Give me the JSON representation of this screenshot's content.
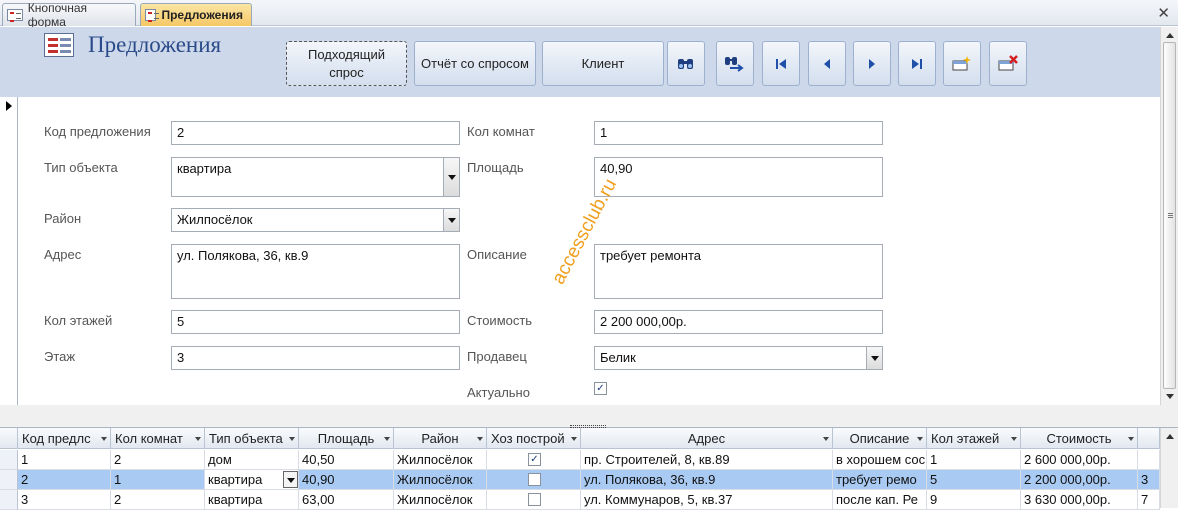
{
  "tabs": [
    {
      "label": "Кнопочная форма",
      "active": false
    },
    {
      "label": "Предложения",
      "active": true
    }
  ],
  "header": {
    "title": "Предложения",
    "buttons": {
      "match_demand_line1": "Подходящий",
      "match_demand_line2": "спрос",
      "report_demand": "Отчёт со спросом",
      "client": "Клиент"
    },
    "icon_buttons": [
      "find-icon",
      "replace-icon",
      "first-record-icon",
      "previous-record-icon",
      "next-record-icon",
      "last-record-icon",
      "new-record-icon",
      "delete-record-icon"
    ]
  },
  "form": {
    "labels": {
      "kod": "Код предложения",
      "tip": "Тип объекта",
      "rayon": "Район",
      "adres": "Адрес",
      "etazhey": "Кол этажей",
      "etazh": "Этаж",
      "komnat": "Кол комнат",
      "ploshad": "Площадь",
      "opisanie": "Описание",
      "stoimost": "Стоимость",
      "prodavec": "Продавец",
      "aktualno": "Актуально"
    },
    "values": {
      "kod": "2",
      "tip": "квартира",
      "rayon": "Жилпосёлок",
      "adres": "ул. Полякова, 36, кв.9",
      "etazhey": "5",
      "etazh": "3",
      "komnat": "1",
      "ploshad": "40,90",
      "opisanie": "требует ремонта",
      "stoimost": "2 200 000,00р.",
      "prodavec": "Белик",
      "aktualno": true
    }
  },
  "watermark": "accessclub.ru",
  "datasheet": {
    "columns": [
      "Код предлс",
      "Кол комнат",
      "Тип объекта",
      "Площадь",
      "Район",
      "Хоз построй",
      "Адрес",
      "Описание",
      "Кол этажей",
      "Стоимость",
      ""
    ],
    "rows": [
      {
        "kod": "1",
        "komnat": "2",
        "tip": "дом",
        "ploshad": "40,50",
        "rayon": "Жилпосёлок",
        "hoz": true,
        "adres": "пр. Строителей, 8, кв.89",
        "opisanie": "в хорошем сос",
        "etazhey": "1",
        "stoimost": "2 600 000,00р.",
        "extra": ""
      },
      {
        "kod": "2",
        "komnat": "1",
        "tip": "квартира",
        "ploshad": "40,90",
        "rayon": "Жилпосёлок",
        "hoz": false,
        "adres": "ул. Полякова, 36, кв.9",
        "opisanie": "требует ремо",
        "etazhey": "5",
        "stoimost": "2 200 000,00р.",
        "extra": "3"
      },
      {
        "kod": "3",
        "komnat": "2",
        "tip": "квартира",
        "ploshad": "63,00",
        "rayon": "Жилпосёлок",
        "hoz": false,
        "adres": "ул. Коммунаров, 5, кв.37",
        "opisanie": "после кап. Ре",
        "etazhey": "9",
        "stoimost": "3 630 000,00р.",
        "extra": "7"
      }
    ]
  },
  "colors": {
    "header_bg": "#cdd9ea",
    "title": "#2b4a8a",
    "selected_row": "#a9caf2",
    "watermark": "#f0a020"
  }
}
